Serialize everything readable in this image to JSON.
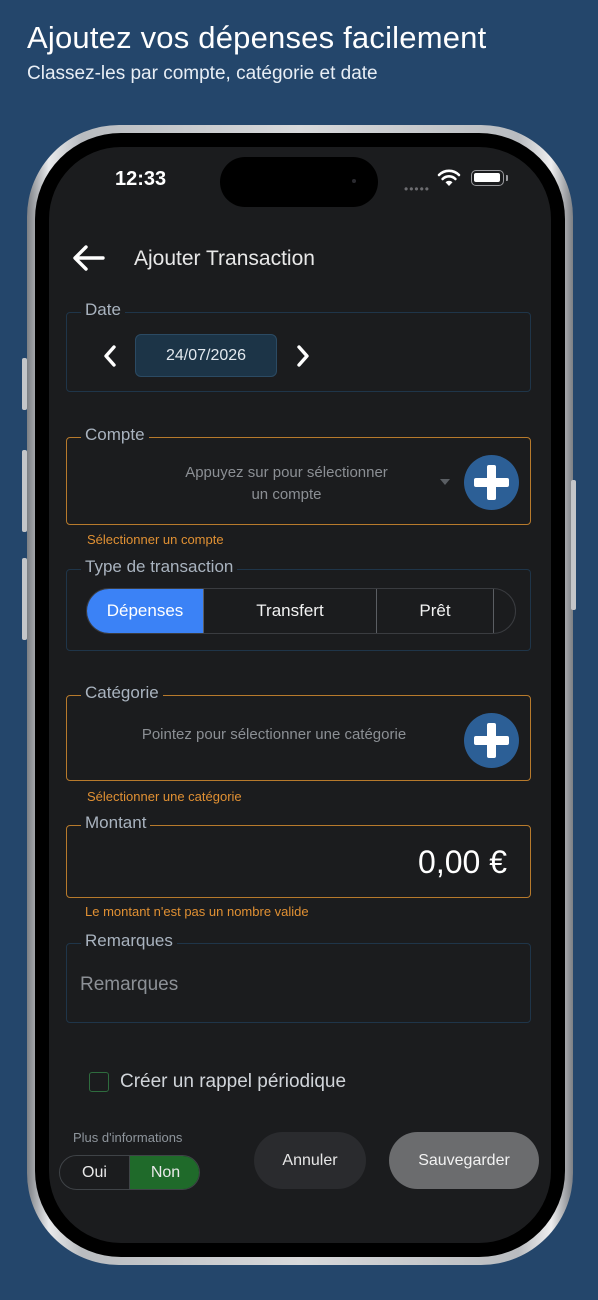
{
  "promo": {
    "title": "Ajoutez vos dépenses facilement",
    "subtitle": "Classez-les par compte, catégorie et date"
  },
  "status_bar": {
    "time": "12:33",
    "signal": "•••••",
    "icons": [
      "wifi-icon",
      "battery-icon"
    ]
  },
  "header": {
    "back_icon": "arrow-left-icon",
    "title": "Ajouter Transaction"
  },
  "date": {
    "legend": "Date",
    "prev_icon": "chevron-left-icon",
    "next_icon": "chevron-right-icon",
    "value": "24/07/2026"
  },
  "account": {
    "legend": "Compte",
    "placeholder_line1": "Appuyez sur pour sélectionner",
    "placeholder_line2": "un compte",
    "error": "Sélectionner un compte"
  },
  "transaction_type": {
    "legend": "Type de transaction",
    "options": [
      "Dépenses",
      "Transfert",
      "Prêt"
    ],
    "selected": "Dépenses"
  },
  "category": {
    "legend": "Catégorie",
    "placeholder": "Pointez pour sélectionner une catégorie",
    "error": "Sélectionner une catégorie"
  },
  "amount": {
    "legend": "Montant",
    "value": "0,00 €",
    "error": "Le montant n'est pas un nombre valide"
  },
  "remarks": {
    "legend": "Remarques",
    "placeholder": "Remarques"
  },
  "reminder": {
    "label": "Créer un rappel périodique",
    "checked": false
  },
  "footer": {
    "more_info_label": "Plus d'informations",
    "toggle_options": [
      "Oui",
      "Non"
    ],
    "toggle_selected": "Non",
    "cancel_label": "Annuler",
    "save_label": "Sauvegarder"
  },
  "colors": {
    "background": "#24466b",
    "screen": "#1b1c1e",
    "accent_blue": "#3b82f6",
    "plus_button": "#2c5f96",
    "error_orange": "#e09033",
    "toggle_green": "#1f6a2a"
  }
}
